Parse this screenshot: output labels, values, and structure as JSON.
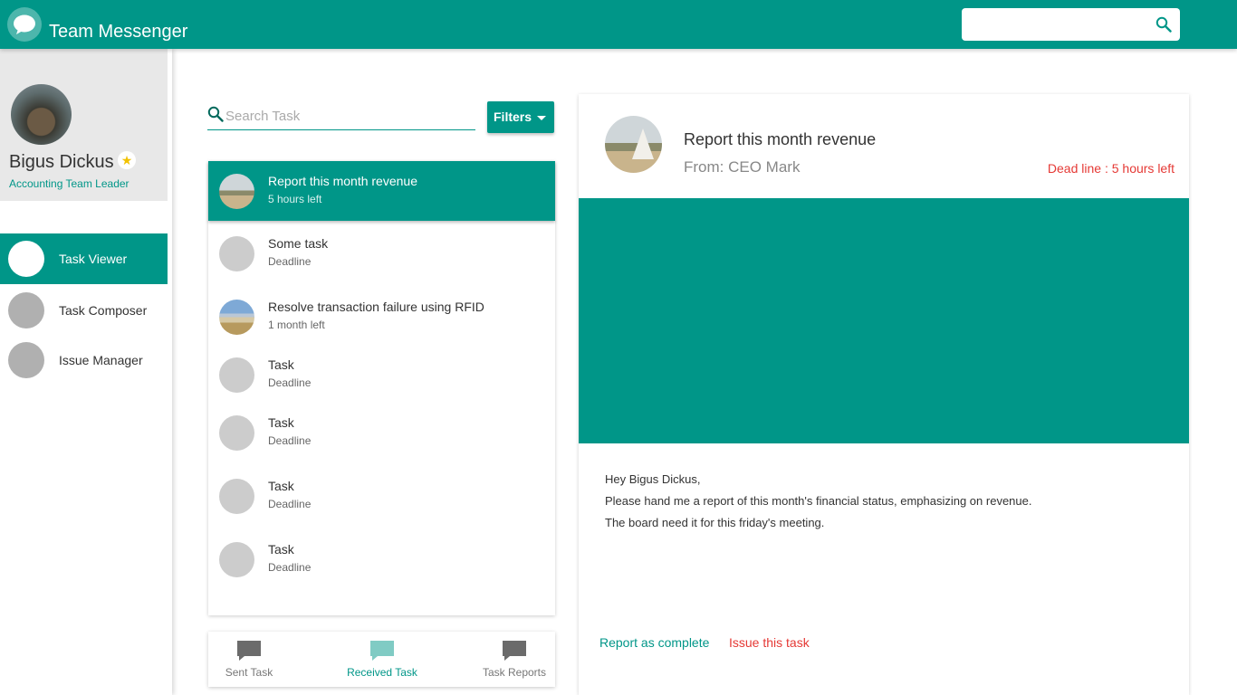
{
  "app": {
    "title": "Team Messenger",
    "logo_icon": "chat-bubble-icon",
    "search_placeholder": "",
    "search_icon": "search-icon"
  },
  "colors": {
    "primary": "#009688",
    "danger": "#e53935",
    "star": "#f2c200"
  },
  "profile": {
    "name": "Bigus Dickus",
    "role": "Accounting Team Leader",
    "badge_icon": "star-icon"
  },
  "nav": {
    "items": [
      {
        "label": "Task Viewer",
        "active": true
      },
      {
        "label": "Task Composer",
        "active": false
      },
      {
        "label": "Issue Manager",
        "active": false
      }
    ]
  },
  "task_search": {
    "placeholder": "Search Task",
    "filters_label": "Filters"
  },
  "tasks": [
    {
      "title": "Report this month revenue",
      "sub": "5 hours left",
      "active": true,
      "thumb": "photo"
    },
    {
      "title": "Some task",
      "sub": "Deadline",
      "active": false,
      "thumb": "placeholder"
    },
    {
      "title": "Resolve transaction failure using RFID",
      "sub": "1 month left",
      "active": false,
      "thumb": "photo"
    },
    {
      "title": "Task",
      "sub": "Deadline",
      "active": false,
      "thumb": "placeholder"
    },
    {
      "title": "Task",
      "sub": "Deadline",
      "active": false,
      "thumb": "placeholder"
    },
    {
      "title": "Task",
      "sub": "Deadline",
      "active": false,
      "thumb": "placeholder"
    },
    {
      "title": "Task",
      "sub": "Deadline",
      "active": false,
      "thumb": "placeholder"
    }
  ],
  "bottom_tabs": [
    {
      "label": "Sent Task",
      "active": false,
      "icon": "message-icon"
    },
    {
      "label": "Received Task",
      "active": true,
      "icon": "message-icon"
    },
    {
      "label": "Task Reports",
      "active": false,
      "icon": "message-icon"
    }
  ],
  "detail": {
    "title": "Report this month revenue",
    "from": "From: CEO Mark",
    "deadline": "Dead line : 5 hours left",
    "body": [
      "Hey Bigus Dickus,",
      "Please hand me a report of this month's financial status, emphasizing on revenue.",
      "The board need it for this friday's meeting."
    ],
    "action_complete": "Report as complete",
    "action_issue": "Issue this task"
  }
}
